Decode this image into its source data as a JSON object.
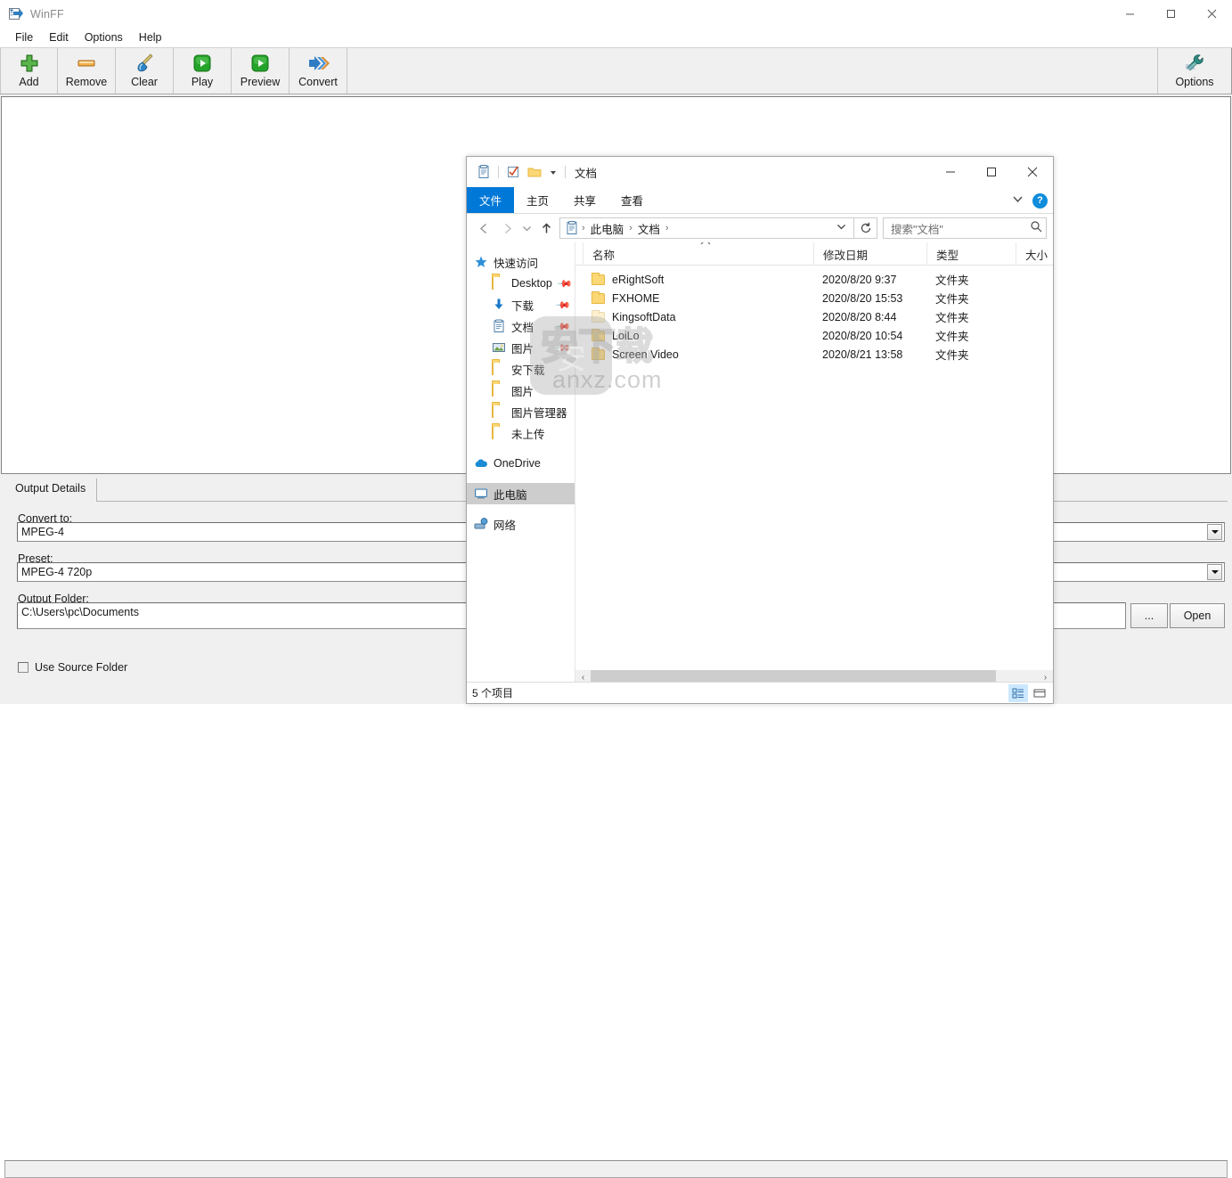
{
  "winff": {
    "title": "WinFF",
    "title_icon": "winff-app-icon",
    "caption": {
      "minimize": "minimize-icon",
      "maximize": "maximize-icon",
      "close": "close-icon"
    },
    "menu": [
      "File",
      "Edit",
      "Options",
      "Help"
    ],
    "toolbar_left": [
      {
        "label": "Add",
        "icon": "plus-icon"
      },
      {
        "label": "Remove",
        "icon": "minus-bar-icon"
      },
      {
        "label": "Clear",
        "icon": "brush-icon"
      },
      {
        "label": "Play",
        "icon": "play-icon"
      },
      {
        "label": "Preview",
        "icon": "play-icon"
      },
      {
        "label": "Convert",
        "icon": "convert-arrows-icon"
      }
    ],
    "toolbar_right": [
      {
        "label": "Options",
        "icon": "wrench-icon"
      }
    ],
    "tab": "Output Details",
    "fields": {
      "convert_to_label": "Convert to:",
      "convert_to_value": "MPEG-4",
      "preset_label": "Preset:",
      "preset_value": "MPEG-4 720p",
      "output_folder_label": "Output Folder:",
      "output_folder_value": "C:\\Users\\pc\\Documents",
      "browse_button": "...",
      "open_button": "Open",
      "use_source_folder": "Use Source Folder"
    }
  },
  "explorer": {
    "title": "文档",
    "qat": [
      "documents-icon",
      "checklist-icon",
      "folder-icon",
      "chevron-down-icon"
    ],
    "caption": {
      "minimize": "minimize-icon",
      "maximize": "maximize-icon",
      "close": "close-icon"
    },
    "ribbon_tabs": [
      {
        "label": "文件",
        "active": true
      },
      {
        "label": "主页",
        "active": false
      },
      {
        "label": "共享",
        "active": false
      },
      {
        "label": "查看",
        "active": false
      }
    ],
    "ribbon_help": "?",
    "address": {
      "back": "back-arrow-icon",
      "forward": "forward-arrow-icon",
      "recent": "chevron-down-icon",
      "up": "up-arrow-icon",
      "crumbs": [
        "此电脑",
        "文档"
      ],
      "dropdown": "chevron-down-icon",
      "refresh": "refresh-icon"
    },
    "search": {
      "placeholder": "搜索\"文档\"",
      "icon": "search-icon"
    },
    "nav": [
      {
        "label": "快速访问",
        "icon": "star-icon",
        "indent": false,
        "pinned": false,
        "selected": false
      },
      {
        "label": "Desktop",
        "icon": "folder-icon",
        "indent": true,
        "pinned": true,
        "selected": false
      },
      {
        "label": "下载",
        "icon": "download-icon",
        "indent": true,
        "pinned": true,
        "selected": false
      },
      {
        "label": "文档",
        "icon": "documents-icon",
        "indent": true,
        "pinned": true,
        "selected": false
      },
      {
        "label": "图片",
        "icon": "pictures-icon",
        "indent": true,
        "pinned": true,
        "selected": false
      },
      {
        "label": "安下载",
        "icon": "folder-icon",
        "indent": true,
        "pinned": false,
        "selected": false
      },
      {
        "label": "图片",
        "icon": "folder-icon",
        "indent": true,
        "pinned": false,
        "selected": false
      },
      {
        "label": "图片管理器",
        "icon": "folder-icon",
        "indent": true,
        "pinned": false,
        "selected": false
      },
      {
        "label": "未上传",
        "icon": "folder-icon",
        "indent": true,
        "pinned": false,
        "selected": false
      },
      {
        "label": "OneDrive",
        "icon": "cloud-icon",
        "indent": false,
        "pinned": false,
        "selected": false
      },
      {
        "label": "此电脑",
        "icon": "computer-icon",
        "indent": false,
        "pinned": false,
        "selected": true
      },
      {
        "label": "网络",
        "icon": "network-icon",
        "indent": false,
        "pinned": false,
        "selected": false
      }
    ],
    "columns": [
      "名称",
      "修改日期",
      "类型",
      "大小"
    ],
    "rows": [
      {
        "name": "eRightSoft",
        "date": "2020/8/20 9:37",
        "type": "文件夹",
        "pale": false
      },
      {
        "name": "FXHOME",
        "date": "2020/8/20 15:53",
        "type": "文件夹",
        "pale": false
      },
      {
        "name": "KingsoftData",
        "date": "2020/8/20 8:44",
        "type": "文件夹",
        "pale": true
      },
      {
        "name": "LoiLo",
        "date": "2020/8/20 10:54",
        "type": "文件夹",
        "pale": false
      },
      {
        "name": "Screen Video",
        "date": "2020/8/21 13:58",
        "type": "文件夹",
        "pale": false
      }
    ],
    "status": {
      "count": "5 个项目",
      "view_details": "details-view-icon",
      "view_tiles": "tiles-view-icon"
    }
  },
  "watermark": {
    "text": "anxz.com",
    "badge": "安",
    "cn": "安下载"
  },
  "colors": {
    "accent": "#0078d7",
    "window_bg": "#f0f0f0",
    "selected_row": "#cde8ff"
  }
}
